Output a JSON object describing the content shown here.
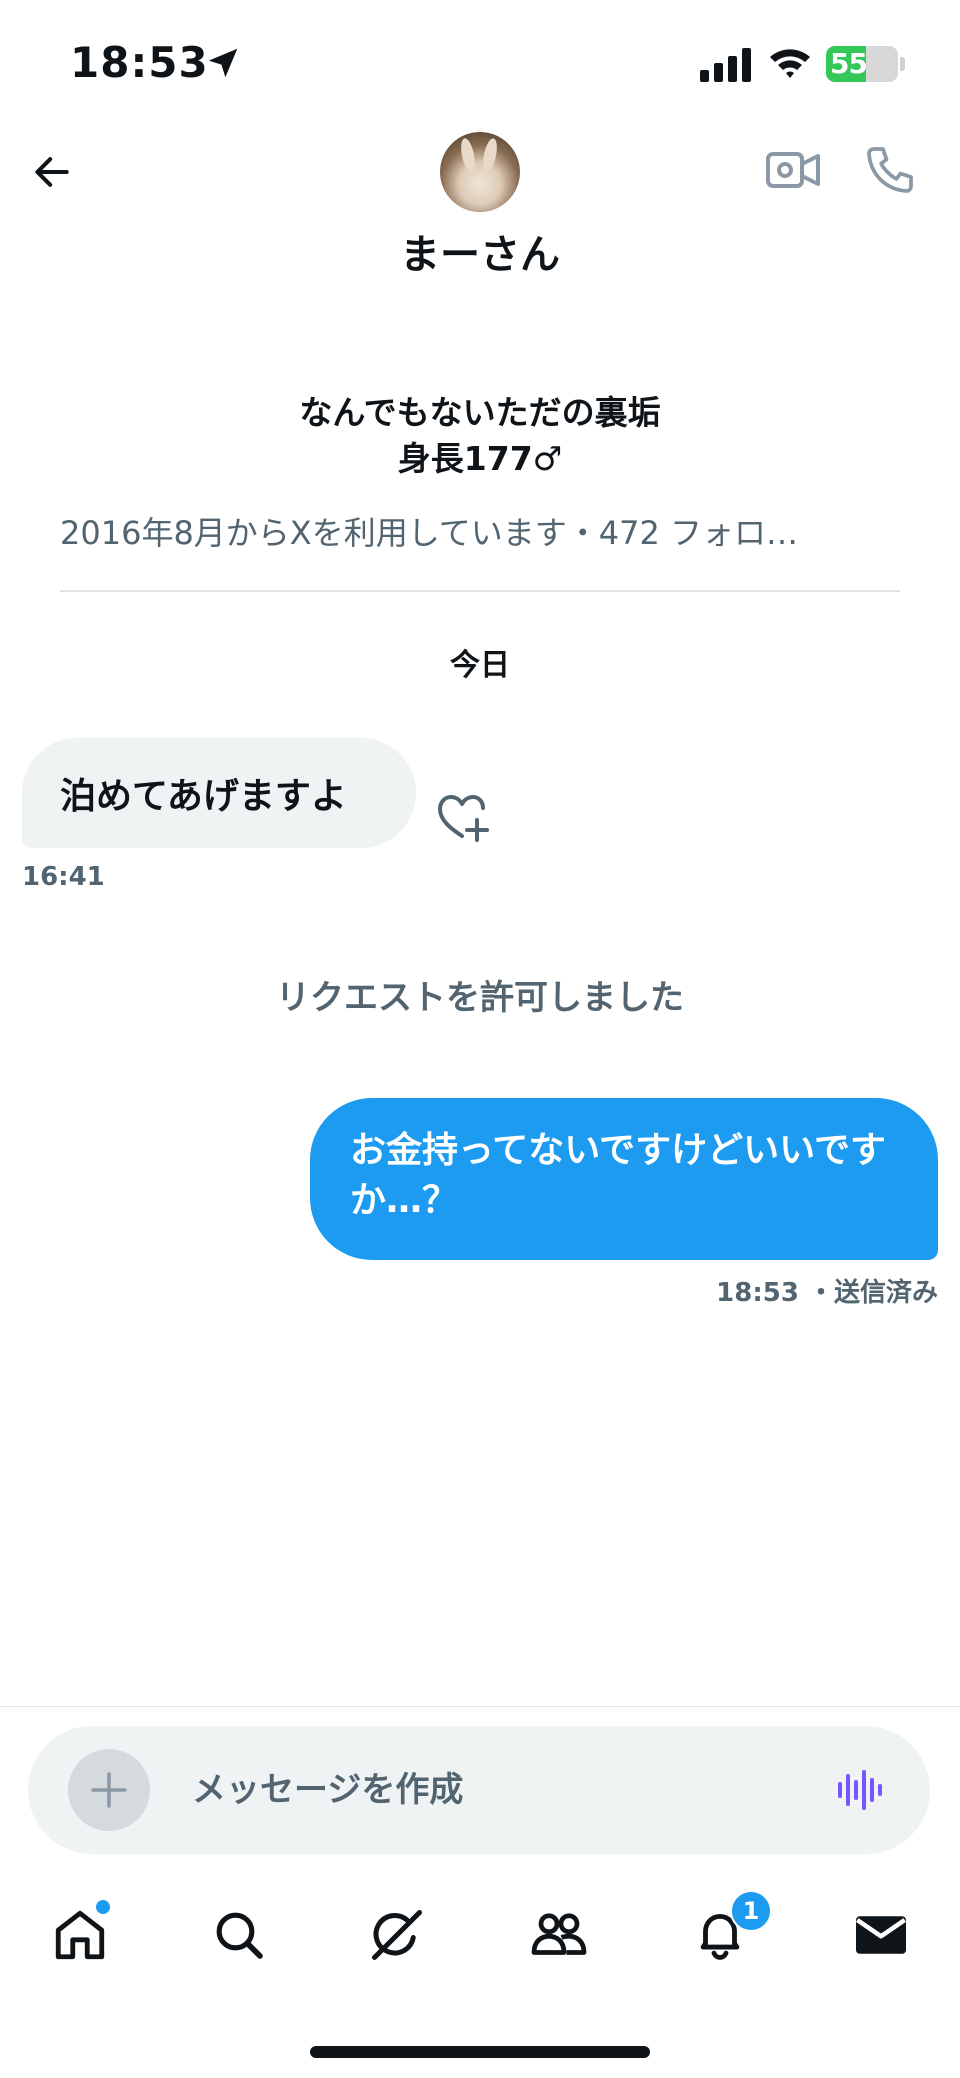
{
  "status_bar": {
    "time": "18:53",
    "battery_percent": 55,
    "battery_label": "55"
  },
  "header": {
    "contact_name": "まーさん"
  },
  "profile": {
    "bio_line1": "なんでもないただの裏垢",
    "bio_line2": "身長177♂",
    "meta": "2016年8月からXを利用しています・472 フォロ…"
  },
  "conversation": {
    "date_separator": "今日",
    "messages": [
      {
        "direction": "incoming",
        "text": "泊めてあげますよ",
        "time": "16:41"
      },
      {
        "direction": "system",
        "text": "リクエストを許可しました"
      },
      {
        "direction": "outgoing",
        "text": "お金持ってないですけどいいですか…？",
        "time": "18:53 ・送信済み"
      }
    ]
  },
  "composer": {
    "placeholder": "メッセージを作成"
  },
  "tab_bar": {
    "items": [
      "home-icon",
      "search-icon",
      "grok-icon",
      "communities-icon",
      "bell-icon",
      "mail-icon"
    ],
    "notifications_badge": "1"
  },
  "colors": {
    "accent": "#1d9bf0",
    "bubble_in": "#eff3f4",
    "muted_text": "#536471",
    "voice_icon": "#7856ff"
  }
}
